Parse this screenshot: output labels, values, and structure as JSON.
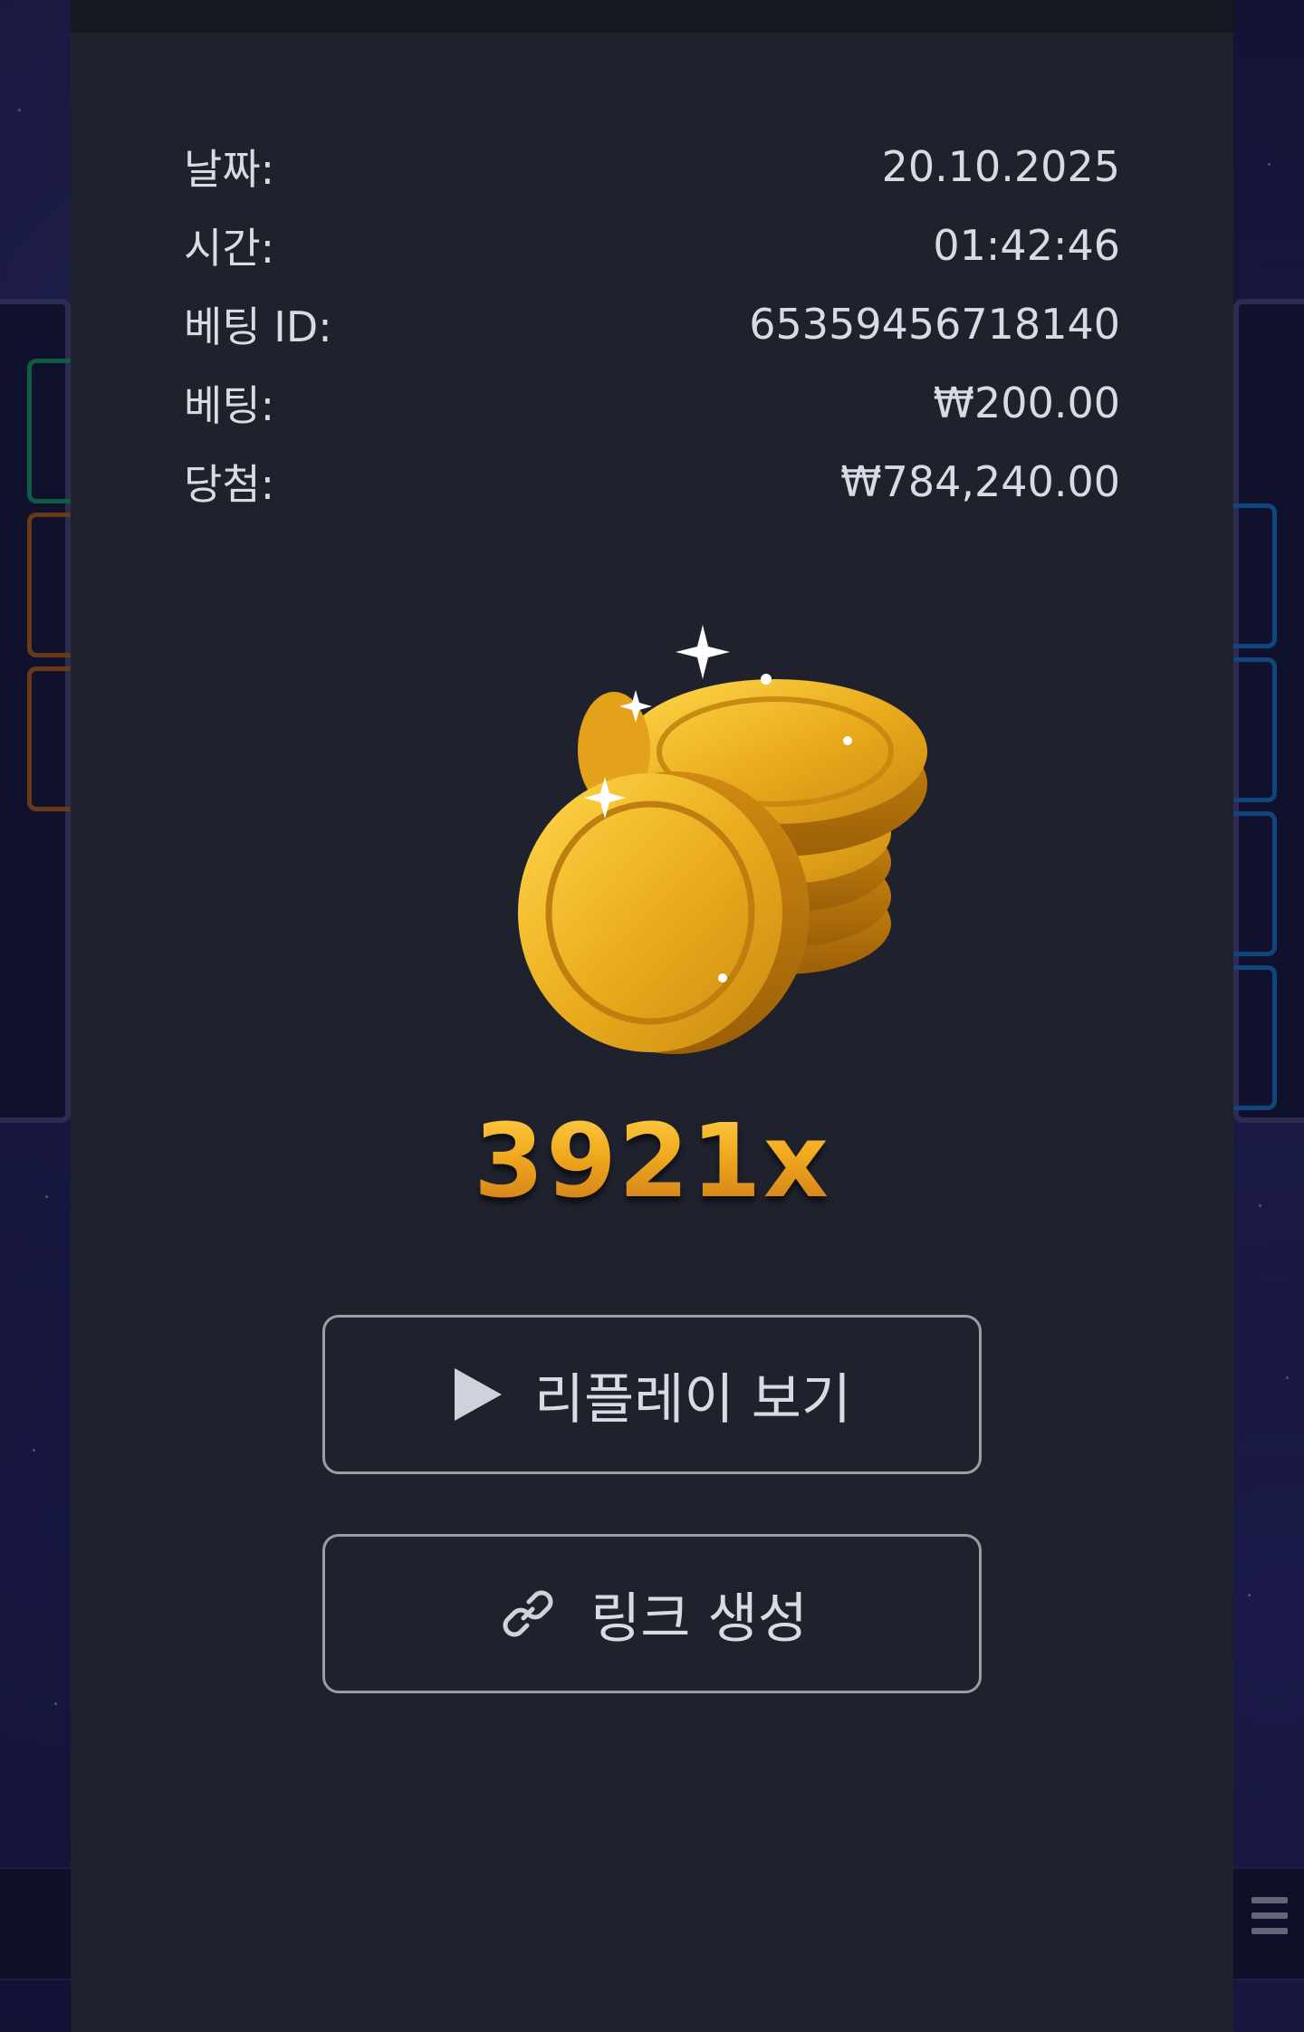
{
  "details": {
    "rows": [
      {
        "label": "날짜:",
        "value": "20.10.2025"
      },
      {
        "label": "시간:",
        "value": "01:42:46"
      },
      {
        "label": "베팅 ID:",
        "value": "65359456718140"
      },
      {
        "label": "베팅:",
        "value": "₩200.00"
      },
      {
        "label": "당첨:",
        "value": "₩784,240.00"
      }
    ]
  },
  "win": {
    "multiplier": "3921x",
    "image": "gold-coins-icon"
  },
  "actions": {
    "replay_label": "리플레이 보기",
    "replay_icon": "play-icon",
    "link_label": "링크 생성",
    "link_icon": "link-icon"
  },
  "colors": {
    "panel_bg": "#1f212d",
    "text": "#d9dbe2",
    "multiplier_gold": "#f0a81e",
    "button_border": "#9a9ca6"
  }
}
